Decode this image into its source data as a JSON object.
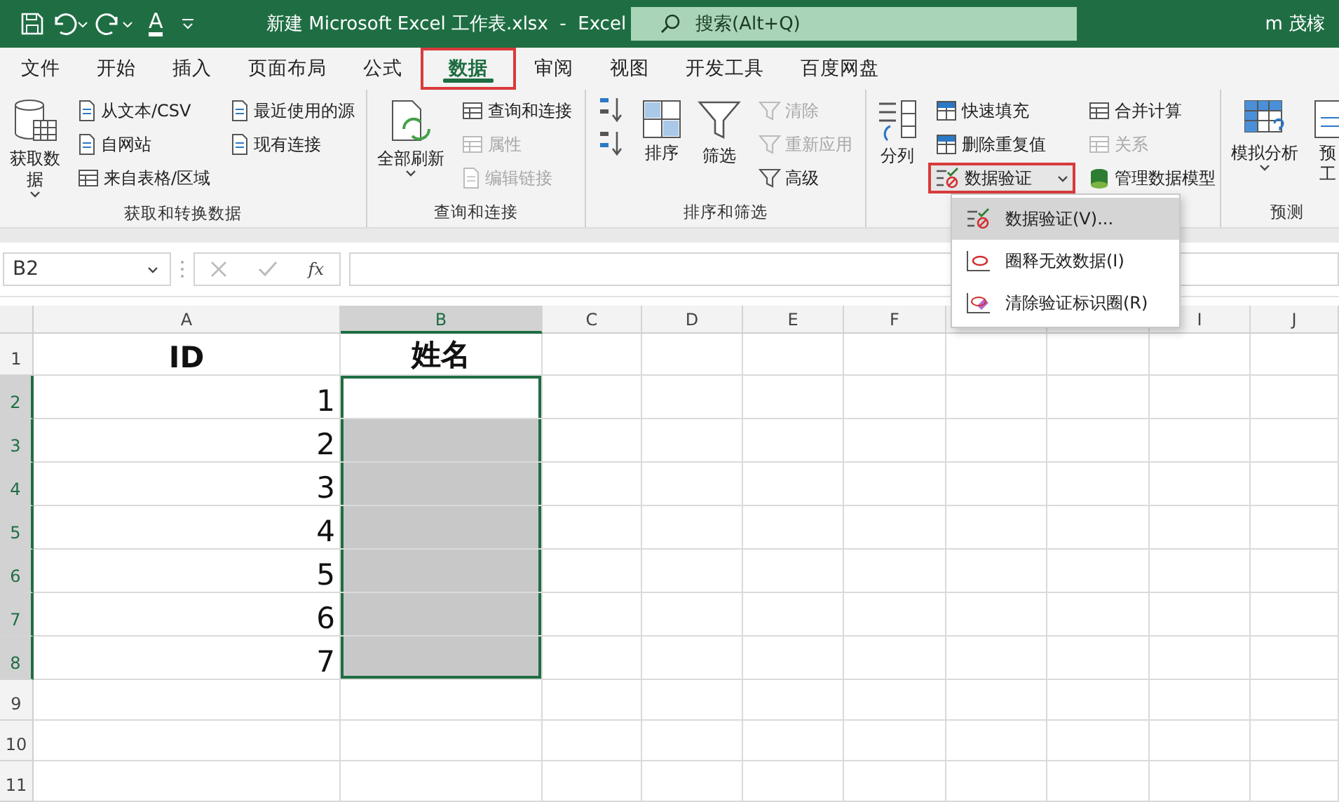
{
  "window": {
    "title": "新建 Microsoft Excel 工作表.xlsx  -  Excel",
    "user": "m 茂榢",
    "font_color_label": "A"
  },
  "search": {
    "placeholder": "搜索(Alt+Q)"
  },
  "tabs": [
    {
      "label": "文件",
      "selected": false,
      "highlighted": false
    },
    {
      "label": "开始",
      "selected": false,
      "highlighted": false
    },
    {
      "label": "插入",
      "selected": false,
      "highlighted": false
    },
    {
      "label": "页面布局",
      "selected": false,
      "highlighted": false
    },
    {
      "label": "公式",
      "selected": false,
      "highlighted": false
    },
    {
      "label": "数据",
      "selected": true,
      "highlighted": true
    },
    {
      "label": "审阅",
      "selected": false,
      "highlighted": false
    },
    {
      "label": "视图",
      "selected": false,
      "highlighted": false
    },
    {
      "label": "开发工具",
      "selected": false,
      "highlighted": false
    },
    {
      "label": "百度网盘",
      "selected": false,
      "highlighted": false
    }
  ],
  "ribbon": {
    "groups": [
      {
        "label": "获取和转换数据",
        "columns": [
          {
            "kind": "large",
            "lines": [
              "获取数",
              "据"
            ],
            "dropdown": true
          },
          {
            "kind": "stack",
            "items": [
              {
                "label": "从文本/CSV",
                "disabled": false
              },
              {
                "label": "自网站",
                "disabled": false
              },
              {
                "label": "来自表格/区域",
                "disabled": false
              }
            ]
          },
          {
            "kind": "stack",
            "items": [
              {
                "label": "最近使用的源",
                "disabled": false
              },
              {
                "label": "现有连接",
                "disabled": false
              }
            ]
          }
        ]
      },
      {
        "label": "查询和连接",
        "columns": [
          {
            "kind": "large",
            "lines": [
              "全部刷新"
            ],
            "dropdown": true
          },
          {
            "kind": "stack",
            "items": [
              {
                "label": "查询和连接",
                "disabled": false
              },
              {
                "label": "属性",
                "disabled": true
              },
              {
                "label": "编辑链接",
                "disabled": true
              }
            ]
          }
        ]
      },
      {
        "label": "排序和筛选",
        "columns": [
          {
            "kind": "stack",
            "items": [
              {
                "disabled": false
              },
              {
                "disabled": false
              }
            ]
          },
          {
            "kind": "large",
            "lines": [
              "排序"
            ],
            "dropdown": false
          },
          {
            "kind": "large",
            "lines": [
              "筛选"
            ],
            "dropdown": false
          },
          {
            "kind": "stack",
            "items": [
              {
                "label": "清除",
                "disabled": true
              },
              {
                "label": "重新应用",
                "disabled": true
              },
              {
                "label": "高级",
                "disabled": false
              }
            ]
          }
        ]
      },
      {
        "columns": [
          {
            "kind": "large",
            "lines": [
              "分列"
            ],
            "dropdown": false
          },
          {
            "kind": "stack",
            "items": [
              {
                "label": "快速填充",
                "disabled": false,
                "dropdown": false,
                "highlighted": false
              },
              {
                "label": "删除重复值",
                "disabled": false,
                "dropdown": false,
                "highlighted": false
              },
              {
                "label": "数据验证",
                "disabled": false,
                "dropdown": true,
                "highlighted": true
              }
            ]
          },
          {
            "kind": "stack",
            "items": [
              {
                "label": "合并计算",
                "disabled": false
              },
              {
                "label": "关系",
                "disabled": true
              },
              {
                "label": "管理数据模型",
                "disabled": false
              }
            ]
          }
        ]
      },
      {
        "label": "预测",
        "columns": [
          {
            "kind": "large",
            "lines": [
              "模拟分析"
            ],
            "dropdown": true
          },
          {
            "kind": "large",
            "lines": [
              "预",
              "工"
            ],
            "dropdown": false
          }
        ]
      }
    ]
  },
  "menu": {
    "items": [
      {
        "label": "数据验证(V)...",
        "selected": true
      },
      {
        "label": "圈释无效数据(I)",
        "selected": false
      },
      {
        "label": "清除验证标识圈(R)",
        "selected": false
      }
    ]
  },
  "formula_bar": {
    "name_box": "B2",
    "function_label": "fx"
  },
  "columns": [
    {
      "label": "A",
      "selected": false
    },
    {
      "label": "B",
      "selected": true
    },
    {
      "label": "C",
      "selected": false
    },
    {
      "label": "D",
      "selected": false
    },
    {
      "label": "E",
      "selected": false
    },
    {
      "label": "F",
      "selected": false
    },
    {
      "selected": false
    },
    {
      "selected": false
    },
    {
      "label": "I",
      "selected": false
    },
    {
      "label": "J",
      "selected": false
    }
  ],
  "rows": [
    {
      "header": "1",
      "selected": false,
      "cells": [
        {
          "kind": "heading",
          "value": "ID"
        },
        {
          "kind": "heading",
          "value": "姓名"
        }
      ]
    },
    {
      "header": "2",
      "selected": true,
      "cells": [
        {
          "kind": "number",
          "value": "1"
        },
        {
          "kind": "empty",
          "selected": true,
          "active": true
        }
      ]
    },
    {
      "header": "3",
      "selected": true,
      "cells": [
        {
          "kind": "number",
          "value": "2"
        },
        {
          "kind": "empty",
          "selected": true,
          "active": false
        }
      ]
    },
    {
      "header": "4",
      "selected": true,
      "cells": [
        {
          "kind": "number",
          "value": "3"
        },
        {
          "kind": "empty",
          "selected": true,
          "active": false
        }
      ]
    },
    {
      "header": "5",
      "selected": true,
      "cells": [
        {
          "kind": "number",
          "value": "4"
        },
        {
          "kind": "empty",
          "selected": true,
          "active": false
        }
      ]
    },
    {
      "header": "6",
      "selected": true,
      "cells": [
        {
          "kind": "number",
          "value": "5"
        },
        {
          "kind": "empty",
          "selected": true,
          "active": false
        }
      ]
    },
    {
      "header": "7",
      "selected": true,
      "cells": [
        {
          "kind": "number",
          "value": "6"
        },
        {
          "kind": "empty",
          "selected": true,
          "active": false
        }
      ]
    },
    {
      "header": "8",
      "selected": true,
      "cells": [
        {
          "kind": "number",
          "value": "7"
        },
        {
          "kind": "empty",
          "selected": true,
          "active": false
        }
      ]
    },
    {
      "header": "9",
      "selected": false,
      "cells": []
    },
    {
      "header": "10",
      "selected": false,
      "cells": []
    },
    {
      "header": "11",
      "selected": false,
      "cells": []
    }
  ]
}
